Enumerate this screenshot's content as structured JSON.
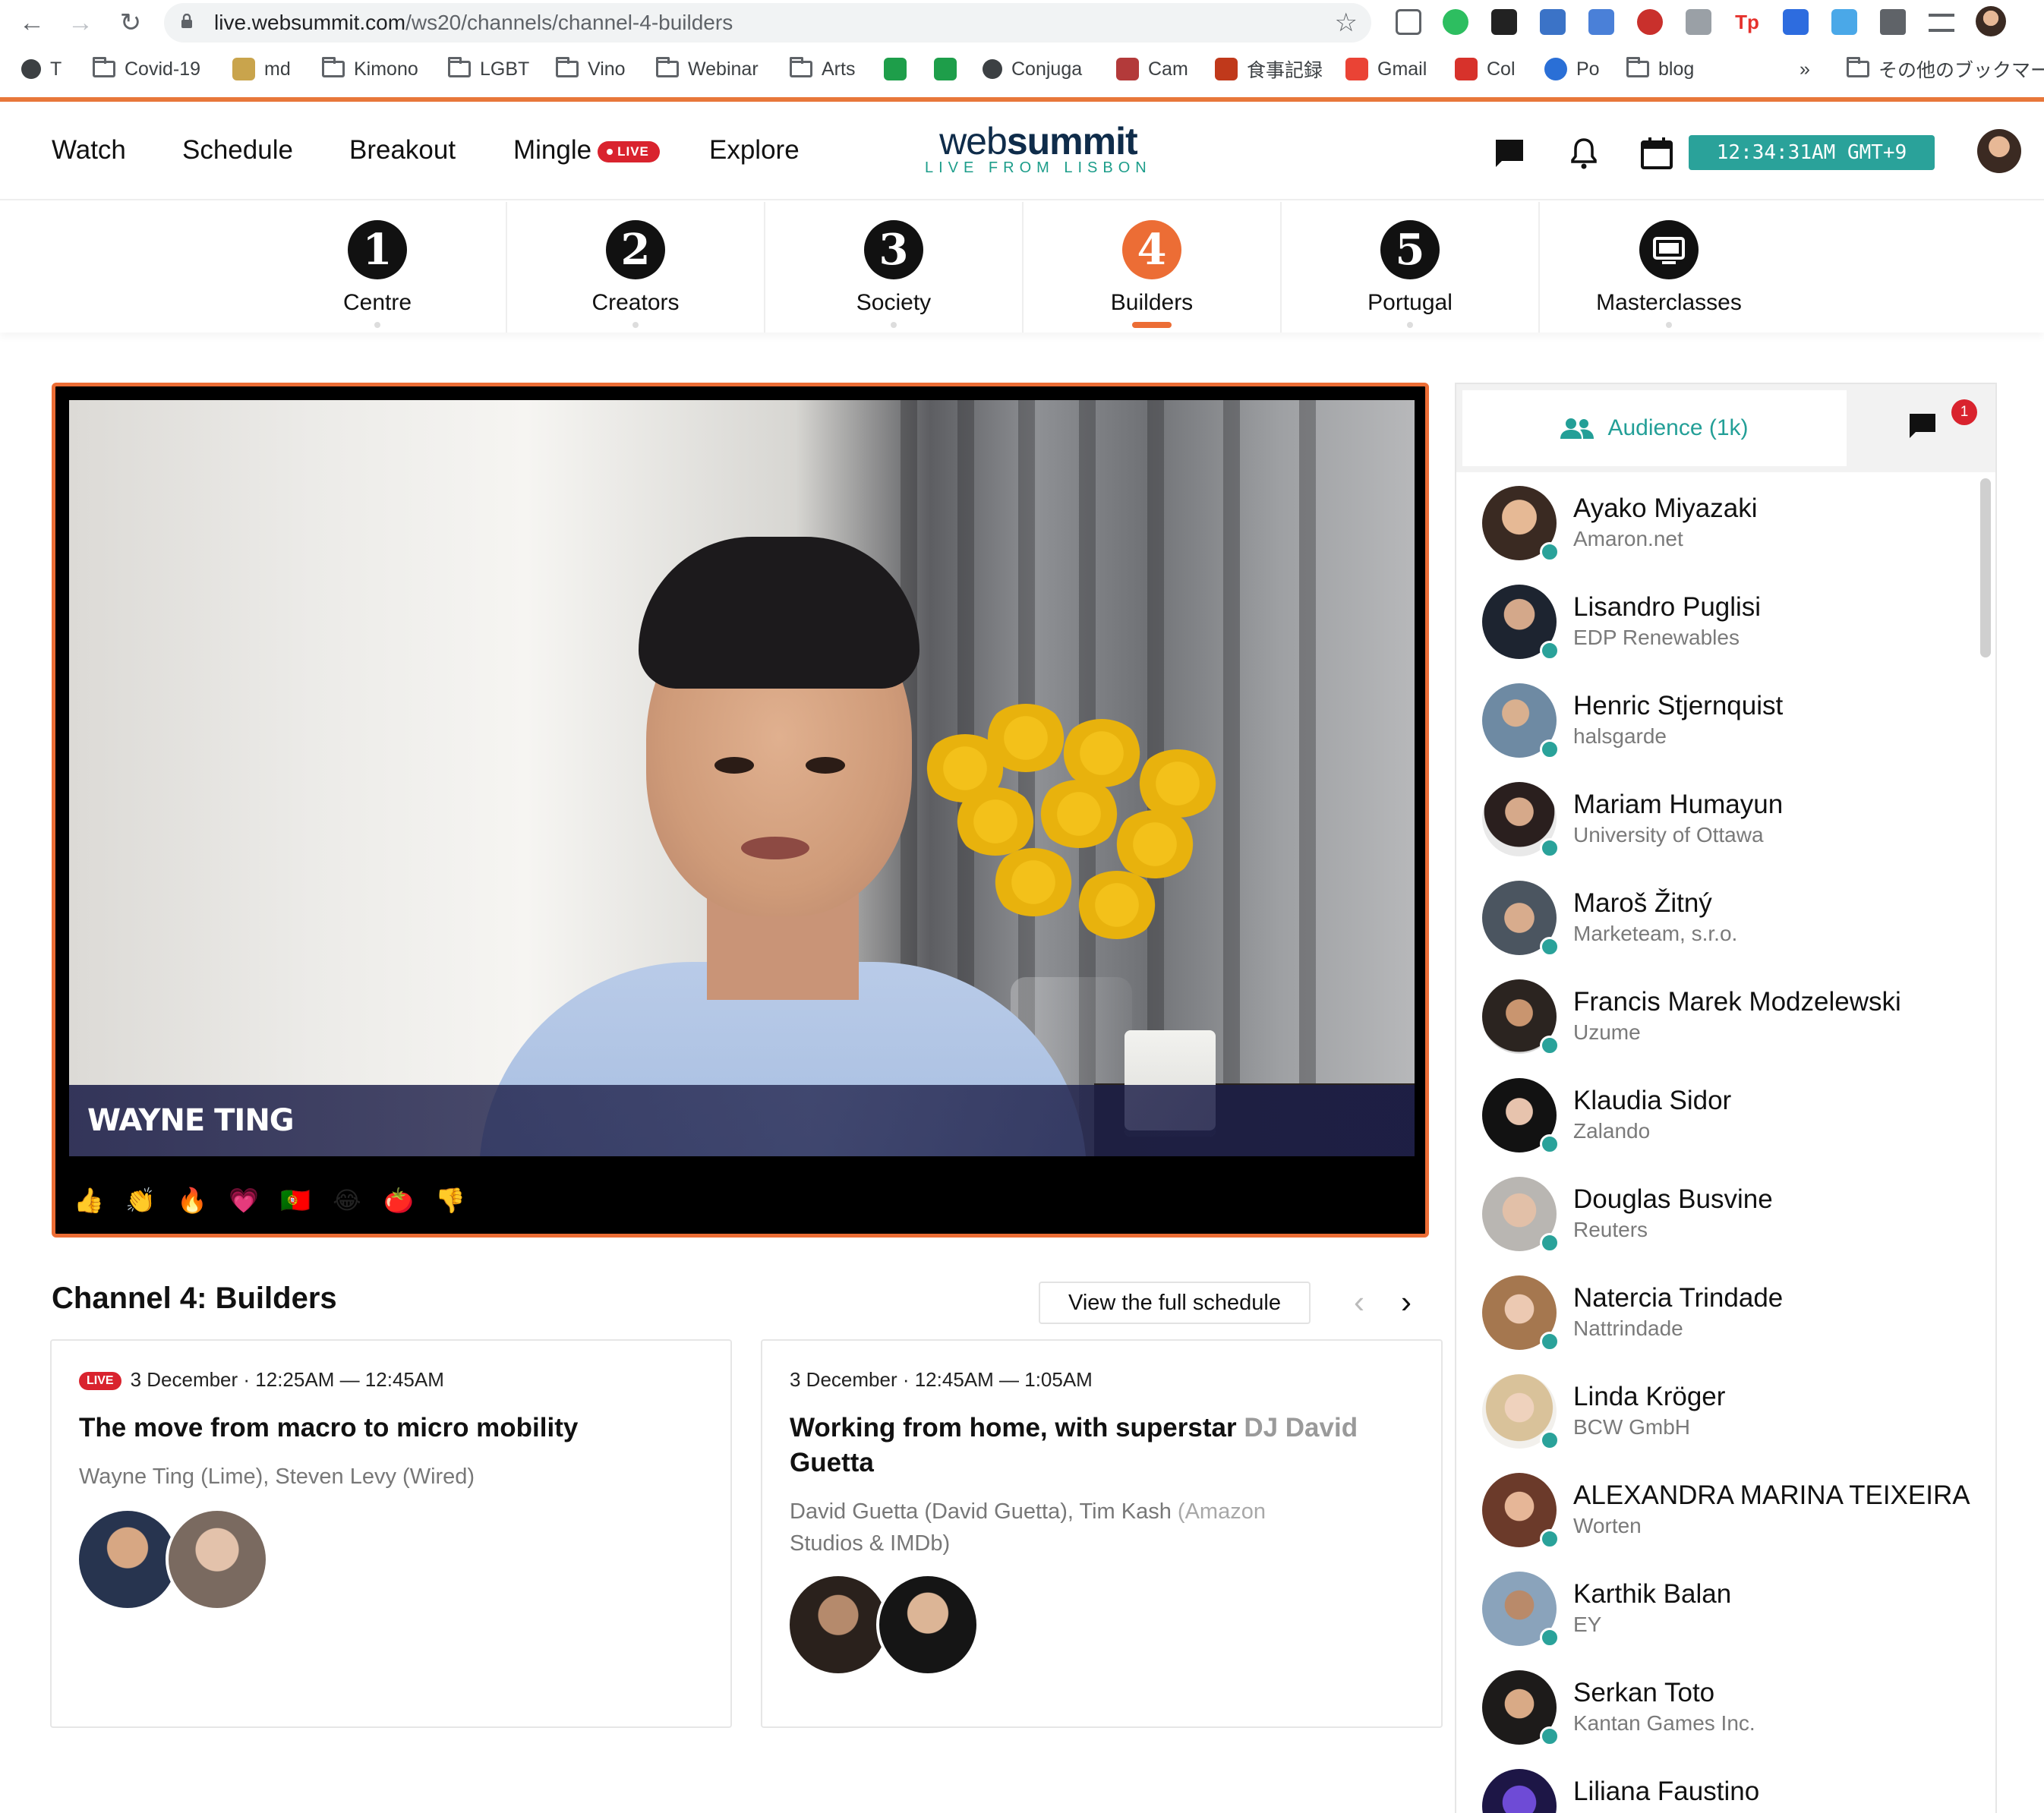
{
  "browser": {
    "url_host": "live.websummit.com",
    "url_path": "/ws20/channels/channel-4-builders",
    "bookmarks": [
      "T",
      "Covid-19",
      "md",
      "Kimono",
      "LGBT",
      "Vino",
      "Webinar",
      "Arts",
      "Conjuga",
      "Cam",
      "食事記録",
      "Gmail",
      "Col",
      "Po",
      "blog"
    ],
    "bookmarks_more": "»",
    "other_bookmarks": "その他のブックマーク"
  },
  "header": {
    "nav": [
      "Watch",
      "Schedule",
      "Breakout",
      "Mingle",
      "Explore"
    ],
    "live_label": "LIVE",
    "logo_light": "web",
    "logo_bold": "summit",
    "logo_tag": "LIVE FROM LISBON",
    "clock": "12:34:31AM GMT+9",
    "accent": "#2aa29a",
    "brand_orange": "#ec6d35"
  },
  "channels": [
    {
      "number": "1",
      "label": "Centre"
    },
    {
      "number": "2",
      "label": "Creators"
    },
    {
      "number": "3",
      "label": "Society"
    },
    {
      "number": "4",
      "label": "Builders",
      "active": true
    },
    {
      "number": "5",
      "label": "Portugal"
    },
    {
      "number": "",
      "label": "Masterclasses",
      "icon": "monitor-icon"
    }
  ],
  "player": {
    "speaker_name": "WAYNE TING",
    "reactions": [
      "👍",
      "👏",
      "🔥",
      "💗",
      "🇵🇹",
      "😂",
      "🍅",
      "👎"
    ]
  },
  "channel_info": {
    "title": "Channel 4: Builders",
    "view_schedule": "View the full schedule",
    "sessions": [
      {
        "live": "LIVE",
        "time": "3 December · 12:25AM — 12:45AM",
        "title": "The move from macro to micro mobility",
        "speakers": "Wayne Ting (Lime), Steven Levy (Wired)"
      },
      {
        "time": "3 December · 12:45AM — 1:05AM",
        "title_main": "Working from home, with superstar",
        "title_fade": " DJ David",
        "title_end": "Guetta",
        "speakers_main": "David Guetta (David Guetta), Tim Kash",
        "speakers_fade": " (Amazon",
        "speakers_end": "Studios & IMDb)"
      }
    ]
  },
  "sidebar": {
    "audience_tab": "Audience (1k)",
    "chat_badge": "1",
    "attendees": [
      {
        "name": "Ayako Miyazaki",
        "company": "Amaron.net"
      },
      {
        "name": "Lisandro Puglisi",
        "company": "EDP Renewables"
      },
      {
        "name": "Henric Stjernquist",
        "company": "halsgarde"
      },
      {
        "name": "Mariam Humayun",
        "company": "University of Ottawa"
      },
      {
        "name": "Maroš Žitný",
        "company": "Marketeam, s.r.o."
      },
      {
        "name": "Francis Marek Modzelewski",
        "company": "Uzume"
      },
      {
        "name": "Klaudia Sidor",
        "company": "Zalando"
      },
      {
        "name": "Douglas Busvine",
        "company": "Reuters"
      },
      {
        "name": "Natercia Trindade",
        "company": "Nattrindade"
      },
      {
        "name": "Linda Kröger",
        "company": "BCW GmbH"
      },
      {
        "name": "ALEXANDRA MARINA TEIXEIRA",
        "company": "Worten"
      },
      {
        "name": "Karthik Balan",
        "company": "EY"
      },
      {
        "name": "Serkan Toto",
        "company": "Kantan Games Inc."
      },
      {
        "name": "Liliana Faustino",
        "company": ""
      }
    ]
  }
}
